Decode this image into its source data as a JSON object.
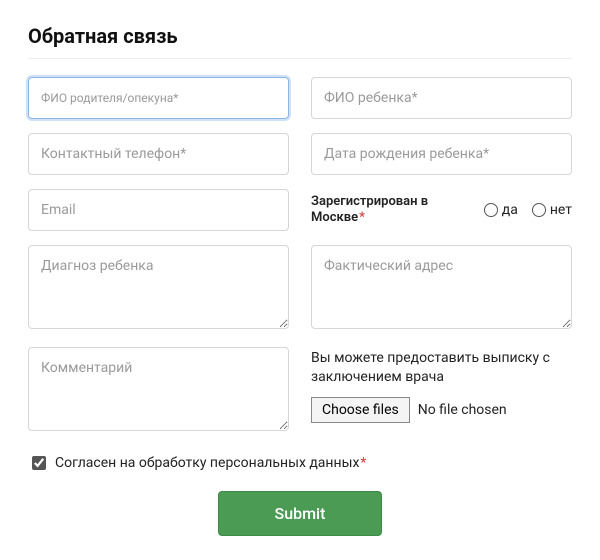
{
  "title": "Обратная связь",
  "fields": {
    "parent_name": {
      "placeholder": "ФИО родителя/опекуна*",
      "value": ""
    },
    "child_name": {
      "placeholder": "ФИО ребенка*",
      "value": ""
    },
    "phone": {
      "placeholder": "Контактный телефон*",
      "value": ""
    },
    "child_dob": {
      "placeholder": "Дата рождения ребенка*",
      "value": ""
    },
    "email": {
      "placeholder": "Email",
      "value": ""
    },
    "diagnosis": {
      "placeholder": "Диагноз ребенка",
      "value": ""
    },
    "address": {
      "placeholder": "Фактический адрес",
      "value": ""
    },
    "comment": {
      "placeholder": "Комментарий",
      "value": ""
    }
  },
  "moscow": {
    "label": "Зарегистрирован в Москве",
    "yes": "да",
    "no": "нет",
    "required": true
  },
  "upload": {
    "caption": "Вы можете предоставить выписку с заключением врача",
    "button": "Choose files",
    "status": "No file chosen"
  },
  "consent": {
    "label": "Согласен на обработку персональных данных",
    "checked": true,
    "required": true
  },
  "submit_label": "Submit"
}
